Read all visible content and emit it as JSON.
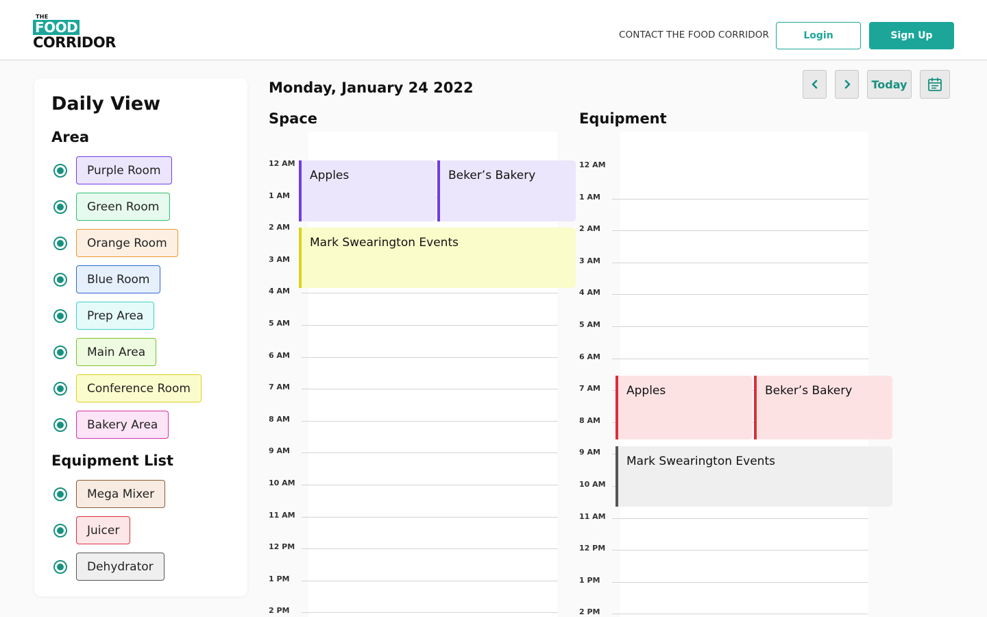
{
  "header": {
    "logo": {
      "the": "THE",
      "food": "FOOD",
      "corridor": "CORRIDOR"
    },
    "contact_label": "CONTACT THE FOOD CORRIDOR",
    "login_label": "Login",
    "signup_label": "Sign Up",
    "brand_color": "#1ba699"
  },
  "sidebar": {
    "title": "Daily View",
    "area_heading": "Area",
    "areas": [
      {
        "label": "Purple Room",
        "bg": "#ece6fc",
        "border": "#6f3ce6"
      },
      {
        "label": "Green Room",
        "bg": "#e6faef",
        "border": "#2fbf70"
      },
      {
        "label": "Orange Room",
        "bg": "#fdf0e2",
        "border": "#ef962c"
      },
      {
        "label": "Blue Room",
        "bg": "#e6f0fd",
        "border": "#2f66cf"
      },
      {
        "label": "Prep Area",
        "bg": "#e4fbfa",
        "border": "#3ed0c8"
      },
      {
        "label": "Main Area",
        "bg": "#eefbe0",
        "border": "#79c02c"
      },
      {
        "label": "Conference Room",
        "bg": "#fbfccd",
        "border": "#dbd21e"
      },
      {
        "label": "Bakery Area",
        "bg": "#fde4f6",
        "border": "#d730a8"
      }
    ],
    "equipment_heading": "Equipment List",
    "equipment": [
      {
        "label": "Mega Mixer",
        "bg": "#f8ece2",
        "border": "#8c5a33"
      },
      {
        "label": "Juicer",
        "bg": "#fde6e8",
        "border": "#d8303c"
      },
      {
        "label": "Dehydrator",
        "bg": "#efefef",
        "border": "#555555"
      }
    ]
  },
  "main": {
    "date": "Monday, January 24 2022",
    "today_label": "Today",
    "prev_icon": "chevron-left-icon",
    "next_icon": "chevron-right-icon",
    "calendar_icon": "calendar-icon",
    "hours": [
      "12 AM",
      "1 AM",
      "2 AM",
      "3 AM",
      "4 AM",
      "5 AM",
      "6 AM",
      "7 AM",
      "8 AM",
      "9 AM",
      "10 AM",
      "11 AM",
      "12 PM",
      "1 PM",
      "2 PM"
    ],
    "space": {
      "title": "Space",
      "events": [
        {
          "label": "Apples",
          "start_hour": 0,
          "end_hour": 1.9,
          "lane": 0,
          "lanes": 2,
          "bg": "#ece6fc",
          "bar": "#6f3ce6"
        },
        {
          "label": "Beker’s Bakery",
          "start_hour": 0,
          "end_hour": 1.9,
          "lane": 1,
          "lanes": 2,
          "bg": "#ece6fc",
          "bar": "#6f3ce6"
        },
        {
          "label": "Mark Swearington Events",
          "start_hour": 2.1,
          "end_hour": 4.0,
          "lane": 0,
          "lanes": 1,
          "bg": "#fafcc9",
          "bar": "#dbd21e"
        }
      ]
    },
    "equipment": {
      "title": "Equipment",
      "events": [
        {
          "label": "Apples",
          "start_hour": 6.7,
          "end_hour": 8.7,
          "lane": 0,
          "lanes": 2,
          "bg": "#fde2e4",
          "bar": "#d8303c"
        },
        {
          "label": "Beker’s Bakery",
          "start_hour": 6.7,
          "end_hour": 8.7,
          "lane": 1,
          "lanes": 2,
          "bg": "#fde2e4",
          "bar": "#d8303c"
        },
        {
          "label": "Mark Swearington Events",
          "start_hour": 8.9,
          "end_hour": 10.8,
          "lane": 0,
          "lanes": 1,
          "bg": "#efefef",
          "bar": "#555555"
        }
      ]
    }
  }
}
